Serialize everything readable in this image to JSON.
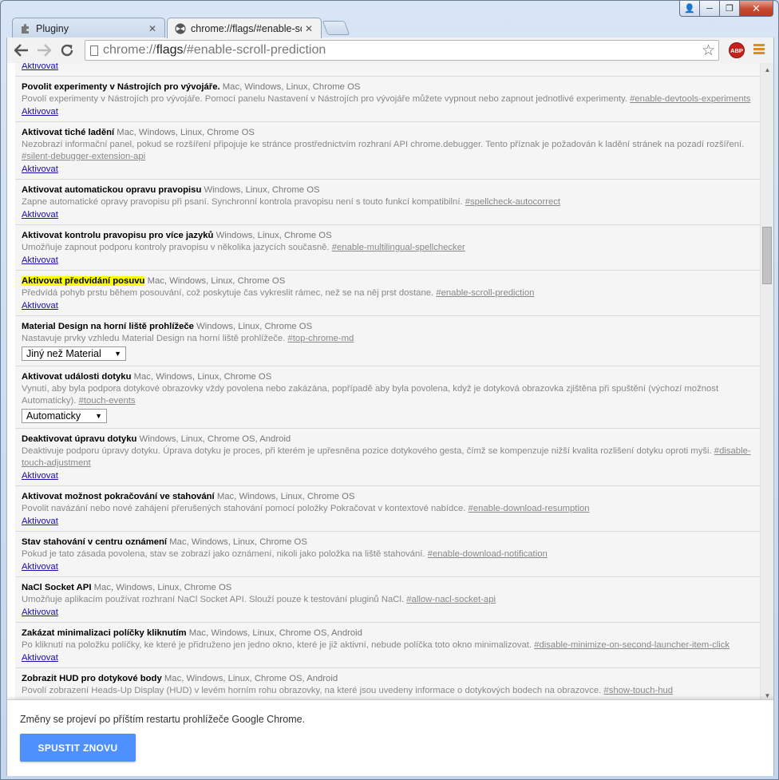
{
  "window": {
    "controls": {
      "close_glyph": "✕",
      "min_glyph": "─",
      "max_glyph": "❐",
      "user_glyph": "👤"
    }
  },
  "tabs": [
    {
      "title": "Pluginy",
      "icon": "puzzle-icon",
      "close_glyph": "✕",
      "active": false
    },
    {
      "title": "chrome://flags/#enable-scroll-prediction",
      "icon": "flask-icon",
      "close_glyph": "✕",
      "active": true
    }
  ],
  "toolbar": {
    "url": {
      "scheme": "chrome://",
      "host": "flags",
      "rest": "/#enable-scroll-prediction"
    },
    "abp_label": "ABP"
  },
  "experiments": [
    {
      "name": "",
      "platforms": "",
      "description": "",
      "flag": "",
      "action": "Aktivovat"
    },
    {
      "name": "Povolit experimenty v Nástrojích pro vývojáře.",
      "platforms": "Mac, Windows, Linux, Chrome OS",
      "description": "Povolí experimenty v Nástrojích pro vývojáře. Pomocí panelu Nastavení v Nástrojích pro vývojáře můžete vypnout nebo zapnout jednotlivé experimenty.",
      "flag": "#enable-devtools-experiments",
      "action": "Aktivovat"
    },
    {
      "name": "Aktivovat tiché ladění",
      "platforms": "Mac, Windows, Linux, Chrome OS",
      "description": "Nezobrazí informační panel, pokud se rozšíření připojuje ke stránce prostřednictvím rozhraní API chrome.debugger. Tento příznak je požadován k ladění stránek na pozadí rozšíření.",
      "flag": "#silent-debugger-extension-api",
      "action": "Aktivovat"
    },
    {
      "name": "Aktivovat automatickou opravu pravopisu",
      "platforms": "Windows, Linux, Chrome OS",
      "description": "Zapne automatické opravy pravopisu při psaní. Synchronní kontrola pravopisu není s touto funkcí kompatibilní.",
      "flag": "#spellcheck-autocorrect",
      "action": "Aktivovat"
    },
    {
      "name": "Aktivovat kontrolu pravopisu pro více jazyků",
      "platforms": "Windows, Linux, Chrome OS",
      "description": "Umožňuje zapnout podporu kontroly pravopisu v několika jazycích současně.",
      "flag": "#enable-multilingual-spellchecker",
      "action": "Aktivovat"
    },
    {
      "name": "Aktivovat předvídání posuvu",
      "platforms": "Mac, Windows, Linux, Chrome OS",
      "description": "Předvídá pohyb prstu během posouvání, což poskytuje čas vykreslit rámec, než se na něj prst dostane.",
      "flag": "#enable-scroll-prediction",
      "action": "Aktivovat",
      "highlight": true
    },
    {
      "name": "Material Design na horní liště prohlížeče",
      "platforms": "Windows, Linux, Chrome OS",
      "description": "Nastavuje prvky vzhledu Material Design na horní liště prohlížeče.",
      "flag": "#top-chrome-md",
      "select": "Jiný než Material"
    },
    {
      "name": "Aktivovat události dotyku",
      "platforms": "Mac, Windows, Linux, Chrome OS",
      "description": "Vynutí, aby byla podpora dotykové obrazovky vždy povolena nebo zakázána, popřípadě aby byla povolena, když je dotyková obrazovka zjištěna při spuštění (výchozí možnost Automaticky).",
      "flag": "#touch-events",
      "select": "Automaticky"
    },
    {
      "name": "Deaktivovat úpravu dotyku",
      "platforms": "Windows, Linux, Chrome OS, Android",
      "description": "Deaktivuje podporu úpravy dotyku. Úprava dotyku je proces, při kterém je upřesněna pozice dotykového gesta, čímž se kompenzuje nižší kvalita rozlišení dotyku oproti myši.",
      "flag": "#disable-touch-adjustment",
      "action": "Aktivovat"
    },
    {
      "name": "Aktivovat možnost pokračování ve stahování",
      "platforms": "Mac, Windows, Linux, Chrome OS",
      "description": "Povolit navázání nebo nové zahájení přerušených stahování pomocí položky Pokračovat v kontextové nabídce.",
      "flag": "#enable-download-resumption",
      "action": "Aktivovat"
    },
    {
      "name": "Stav stahování v centru oznámení",
      "platforms": "Mac, Windows, Linux, Chrome OS",
      "description": "Pokud je tato zásada povolena, stav se zobrazí jako oznámení, nikoli jako položka na liště stahování.",
      "flag": "#enable-download-notification",
      "action": "Aktivovat"
    },
    {
      "name": "NaCl Socket API",
      "platforms": "Mac, Windows, Linux, Chrome OS",
      "description": "Umožňuje aplikacím používat rozhraní NaCl Socket API. Slouží pouze k testování pluginů NaCl.",
      "flag": "#allow-nacl-socket-api",
      "action": "Aktivovat"
    },
    {
      "name": "Zakázat minimalizaci políčky kliknutím",
      "platforms": "Mac, Windows, Linux, Chrome OS, Android",
      "description": "Po kliknutí na položku políčky, ke které je přidruženo jen jedno okno, které je již aktivní, nebude políčka toto okno minimalizovat.",
      "flag": "#disable-minimize-on-second-launcher-item-click",
      "action": "Aktivovat"
    },
    {
      "name": "Zobrazit HUD pro dotykové body",
      "platforms": "Mac, Windows, Linux, Chrome OS, Android",
      "description": "Povolí zobrazení Heads-Up Display (HUD) v levém horním rohu obrazovky, na které jsou uvedeny informace o dotykových bodech na obrazovce.",
      "flag": "#show-touch-hud",
      "action": ""
    }
  ],
  "footer": {
    "message": "Změny se projeví po příštím restartu prohlížeče Google Chrome.",
    "button_label": "SPUSTIT ZNOVU",
    "button_color": "#4d90fe"
  },
  "colors": {
    "highlight": "#ffff00",
    "link": "#1a0dab"
  }
}
